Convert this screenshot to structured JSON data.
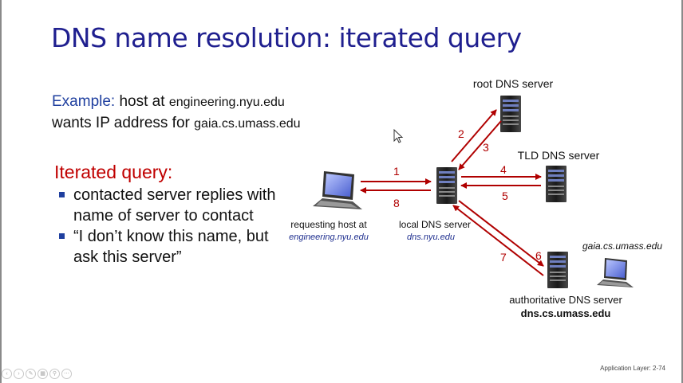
{
  "title": "DNS name resolution: iterated query",
  "example": {
    "label": "Example:",
    "line1_text": "host at",
    "line1_host": "engineering.nyu.edu",
    "line2_text": "wants IP address for",
    "line2_host": "gaia.cs.umass.edu"
  },
  "iterated": {
    "heading": "Iterated query:",
    "bullets": [
      "contacted server replies with name of server to contact",
      "“I don’t know this name, but ask this server”"
    ]
  },
  "diagram": {
    "root_server": "root DNS server",
    "tld_server": "TLD DNS server",
    "requesting_host_label": "requesting host at",
    "requesting_host_name": "engineering.nyu.edu",
    "local_server_label": "local DNS server",
    "local_server_name": "dns.nyu.edu",
    "gaia_name": "gaia.cs.umass.edu",
    "auth_server_label": "authoritative DNS server",
    "auth_server_name": "dns.cs.umass.edu",
    "steps": [
      "1",
      "2",
      "3",
      "4",
      "5",
      "6",
      "7",
      "8"
    ],
    "arrow_color": "#b00000"
  },
  "footer": "Application Layer: 2-74"
}
